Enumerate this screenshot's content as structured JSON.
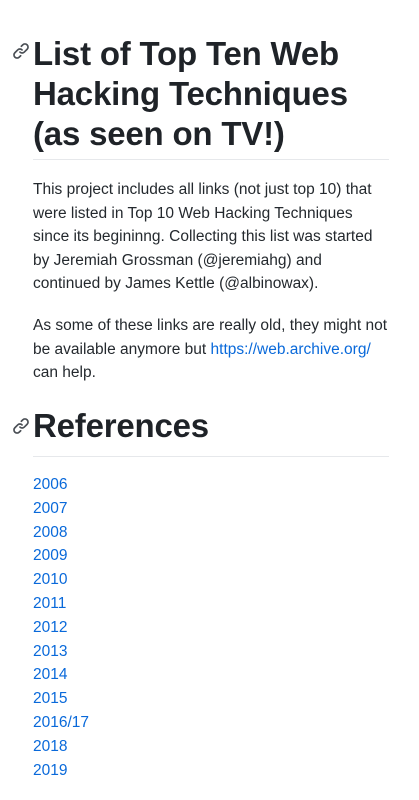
{
  "title": "List of Top Ten Web Hacking Techniques (as seen on TV!)",
  "intro": {
    "paragraph1": "This project includes all links (not just top 10) that were listed in Top 10 Web Hacking Techniques since its begininng. Collecting this list was started by Jeremiah Grossman (@jeremiahg) and continued by James Kettle (@albinowax).",
    "paragraph2_text": "As some of these links are really old, they might not be available anymore but",
    "archive_link": "https://web.archive.org/",
    "paragraph2_suffix": " can help."
  },
  "references": {
    "heading": "References",
    "years": [
      "2006",
      "2007",
      "2008",
      "2009",
      "2010",
      "2011",
      "2012",
      "2013",
      "2014",
      "2015",
      "2016/17",
      "2018",
      "2019"
    ]
  },
  "colors": {
    "link": "#0969da",
    "text": "#24292e",
    "rule": "#e6e8eb"
  },
  "icons": {
    "anchor": "link-icon"
  }
}
